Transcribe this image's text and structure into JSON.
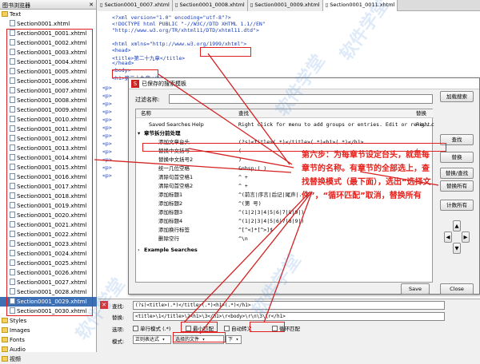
{
  "browser": {
    "title": "图书浏览器",
    "text_folder": "Text",
    "first_file": "Section0001.xhtml",
    "files": [
      "Section0001_0001.xhtml",
      "Section0001_0002.xhtml",
      "Section0001_0003.xhtml",
      "Section0001_0004.xhtml",
      "Section0001_0005.xhtml",
      "Section0001_0006.xhtml",
      "Section0001_0007.xhtml",
      "Section0001_0008.xhtml",
      "Section0001_0009.xhtml",
      "Section0001_0010.xhtml",
      "Section0001_0011.xhtml",
      "Section0001_0012.xhtml",
      "Section0001_0013.xhtml",
      "Section0001_0014.xhtml",
      "Section0001_0015.xhtml",
      "Section0001_0016.xhtml",
      "Section0001_0017.xhtml",
      "Section0001_0018.xhtml",
      "Section0001_0019.xhtml",
      "Section0001_0020.xhtml",
      "Section0001_0021.xhtml",
      "Section0001_0022.xhtml",
      "Section0001_0023.xhtml",
      "Section0001_0024.xhtml",
      "Section0001_0025.xhtml",
      "Section0001_0026.xhtml",
      "Section0001_0027.xhtml",
      "Section0001_0028.xhtml",
      "Section0001_0029.xhtml",
      "Section0001_0030.xhtml"
    ],
    "folders": [
      "Styles",
      "Images",
      "Fonts",
      "Audio",
      "视频"
    ]
  },
  "tabs": [
    "Section0001_0007.xhtml",
    "Section0001_0008.xhtml",
    "Section0001_0009.xhtml",
    "Section0001_0011.xhtml"
  ],
  "code": {
    "lines": [
      "<?xml version=\"1.0\" encoding=\"utf-8\"?>",
      "<!DOCTYPE html PUBLIC \"-//W3C//DTD XHTML 1.1//EN\"",
      "  \"http://www.w3.org/TR/xhtml11/DTD/xhtml11.dtd\">",
      "",
      "<html xmlns=\"http://www.w3.org/1999/xhtml\">",
      "<head>",
      "<title>第二十九章</title>",
      "</head>",
      "<body>",
      "<h1>第二十九章</h1>"
    ],
    "left_fragments": [
      "<p>",
      "<p>",
      "<p>",
      "<p>",
      "<p>",
      "<p>",
      "<p>",
      "<p>",
      "<p>",
      "<p>",
      "<p>",
      "<p>"
    ]
  },
  "dialog": {
    "title": "已保存的搜索模板",
    "filter_label": "过滤名称:",
    "columns": [
      "名称",
      "查找",
      "替换"
    ],
    "rows": [
      {
        "name": "Saved Searches Help",
        "find": "Right click for menu to add groups or entries.  Edit or re-o...",
        "repl": "Right c"
      },
      {
        "name": "章节拆分前处理",
        "find": "",
        "repl": ""
      },
      {
        "name": "添加文章台头",
        "find": "(?s)<title>(.*)</title>(.*)<h1>(.*)</h1>",
        "repl": ""
      },
      {
        "name": "替换中文括号",
        "find": "(",
        "repl": "("
      },
      {
        "name": "替换中文括号2",
        "find": ")",
        "repl": ""
      },
      {
        "name": "统一几位空格",
        "find": "&nbsp;(  )",
        "repl": ""
      },
      {
        "name": "清除句首空格1",
        "find": "^ +",
        "repl": ""
      },
      {
        "name": "清除句首空格2",
        "find": "^ +",
        "repl": ""
      },
      {
        "name": "添加标题1",
        "find": "^(前言|序言|后记|尾声|..)",
        "repl": ""
      },
      {
        "name": "添加标题2",
        "find": "^(第 号)",
        "repl": ""
      },
      {
        "name": "添加标题3",
        "find": "^(1|2|3|4|5|6|7|8|9|)",
        "repl": ""
      },
      {
        "name": "添加标题4",
        "find": "^(1|2|3|4|5|6|7|8|9|)",
        "repl": ""
      },
      {
        "name": "添加换行标签",
        "find": "^[^<]*[^>]$",
        "repl": ""
      },
      {
        "name": "删除空行",
        "find": "^\\n",
        "repl": ""
      },
      {
        "name": "Example Searches",
        "find": "",
        "repl": ""
      }
    ],
    "group_label": "轻小说预处理",
    "buttons": [
      "加载搜索",
      "查找",
      "替换",
      "替换/查找",
      "替换所有",
      "计数所有"
    ],
    "save": "Save",
    "close": "Close"
  },
  "note": "第六步：为每章节设定台头，就是每章节的名称。有章节的全部选上，查找替换模式（最下面），选出“选择文件”，“循环匹配”取消，替换所有",
  "bottom": {
    "find_label": "查找:",
    "find_value": "(?s)<title>(.*)</title>(.*)<h1>(.*)</h1>",
    "replace_label": "替换:",
    "replace_value": "<title>\\1</title>\\2<h1>\\3</h1>\\r<body>\\r\\n\\3\\\\r</h1>",
    "options_label": "选项:",
    "opts": [
      "单行模式 (.*)",
      "最小匹配",
      "自动转义",
      "循环匹配"
    ],
    "mode_label": "模式:",
    "mode_value": "正则表达式",
    "scope_value": "选择的文件",
    "dir_value": "下"
  },
  "watermark": "软件学堂"
}
